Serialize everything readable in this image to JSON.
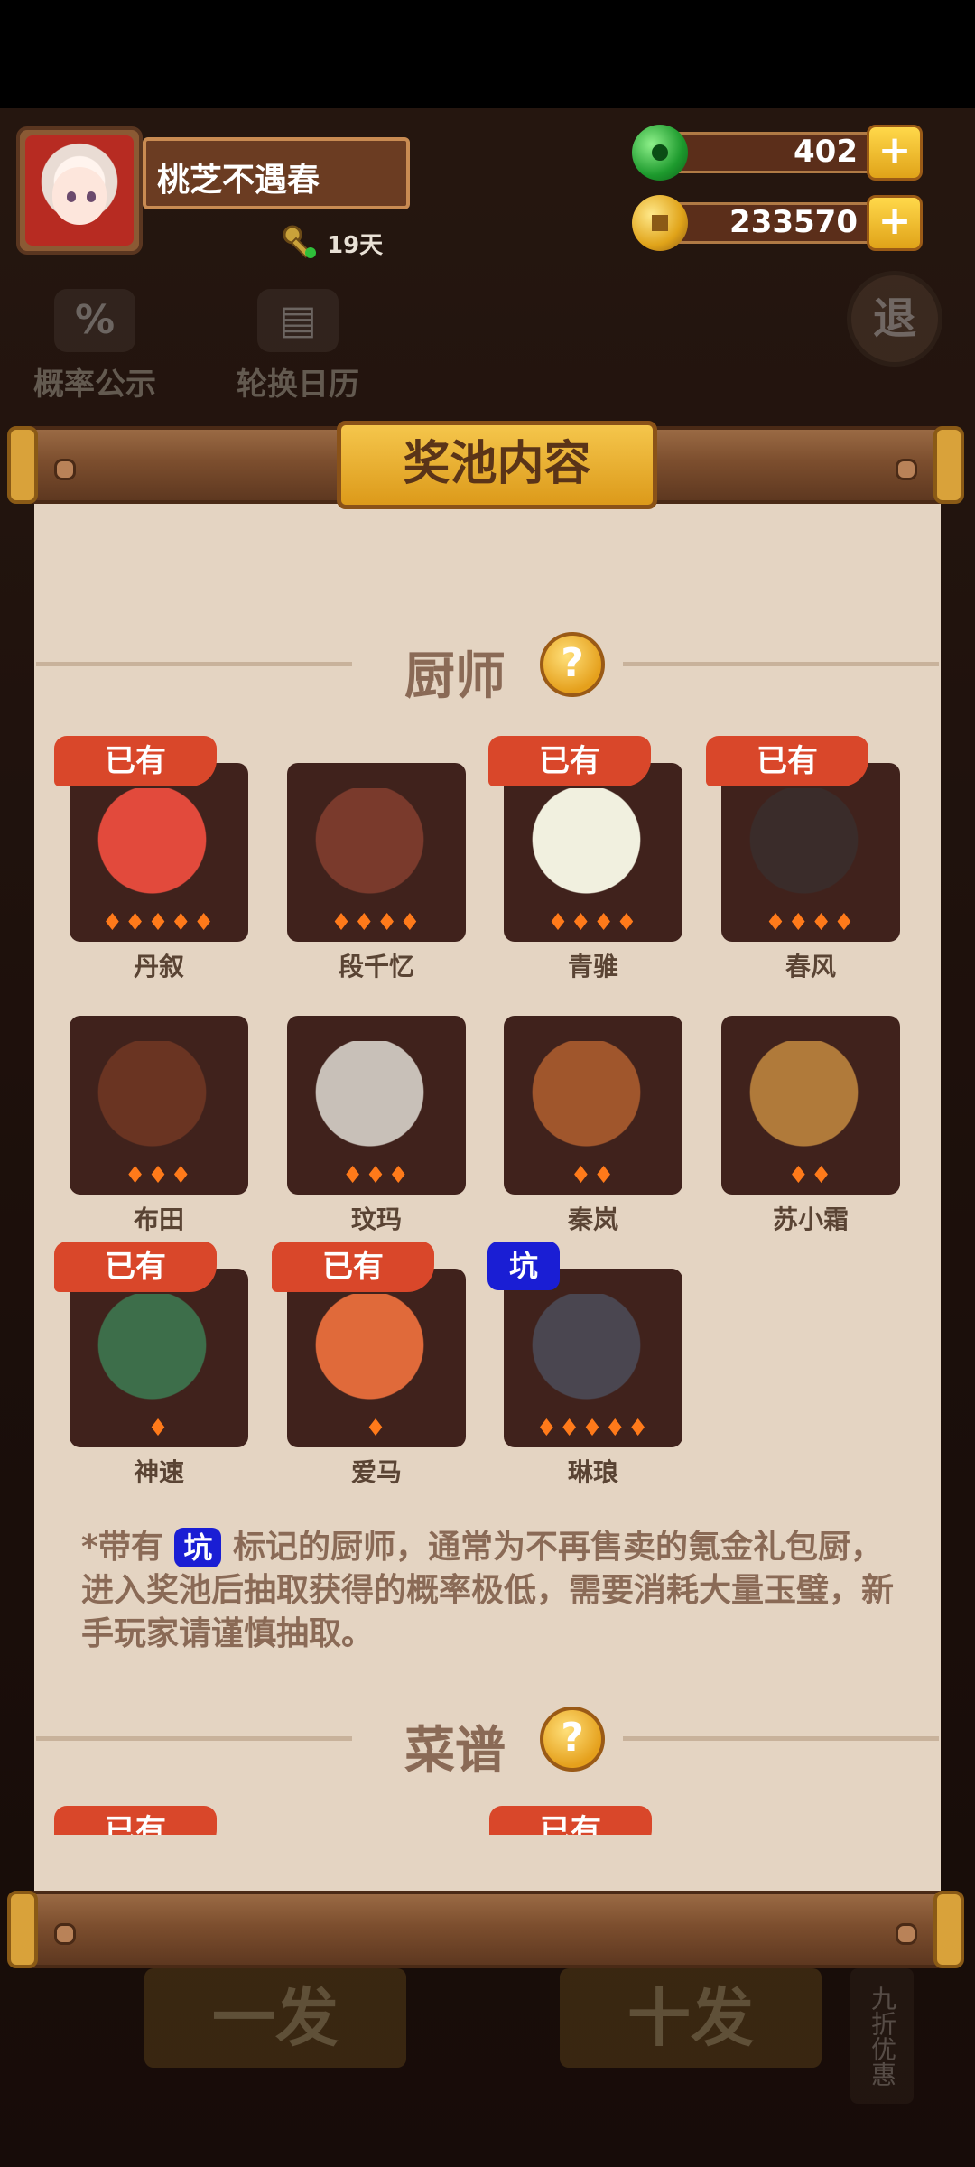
{
  "player": {
    "name": "桃芝不遇春",
    "days": "19天"
  },
  "currency": {
    "jade": "402",
    "coins": "233570"
  },
  "background": {
    "prob_btn": "概率公示",
    "rotation_btn": "轮换日历",
    "exit_btn": "退",
    "draw_one": "一发",
    "draw_ten": "十发",
    "discount": "九折优惠"
  },
  "dialog": {
    "title": "奖池内容",
    "section_chef": "厨师",
    "section_recipe": "菜谱",
    "help_glyph": "?",
    "owned_label": "已有",
    "keng_label": "坑",
    "chefs": [
      {
        "name": "丹叙",
        "owned": true,
        "keng": false,
        "stars": 5,
        "color": "#e24a3c"
      },
      {
        "name": "段千忆",
        "owned": false,
        "keng": false,
        "stars": 4,
        "color": "#7a3a2c"
      },
      {
        "name": "青骓",
        "owned": true,
        "keng": false,
        "stars": 4,
        "color": "#f1f0df"
      },
      {
        "name": "春风",
        "owned": true,
        "keng": false,
        "stars": 4,
        "color": "#3a2c2a"
      },
      {
        "name": "布田",
        "owned": false,
        "keng": false,
        "stars": 3,
        "color": "#6a3422"
      },
      {
        "name": "玟玛",
        "owned": false,
        "keng": false,
        "stars": 3,
        "color": "#c8c0b8"
      },
      {
        "name": "秦岚",
        "owned": false,
        "keng": false,
        "stars": 2,
        "color": "#a0562c"
      },
      {
        "name": "苏小霜",
        "owned": false,
        "keng": false,
        "stars": 2,
        "color": "#b07a3a"
      },
      {
        "name": "神速",
        "owned": true,
        "keng": false,
        "stars": 1,
        "color": "#3d6e4a"
      },
      {
        "name": "爱马",
        "owned": true,
        "keng": false,
        "stars": 1,
        "color": "#e06a3a"
      },
      {
        "name": "琳琅",
        "owned": false,
        "keng": true,
        "stars": 5,
        "color": "#4a4650"
      }
    ],
    "note_prefix": "*带有",
    "note_rest": " 标记的厨师，通常为不再售卖的氪金礼包厨，进入奖池后抽取获得的概率极低，需要消耗大量玉璧，新手玩家请谨慎抽取。",
    "recipe_owned": [
      "已有",
      "已有"
    ]
  }
}
